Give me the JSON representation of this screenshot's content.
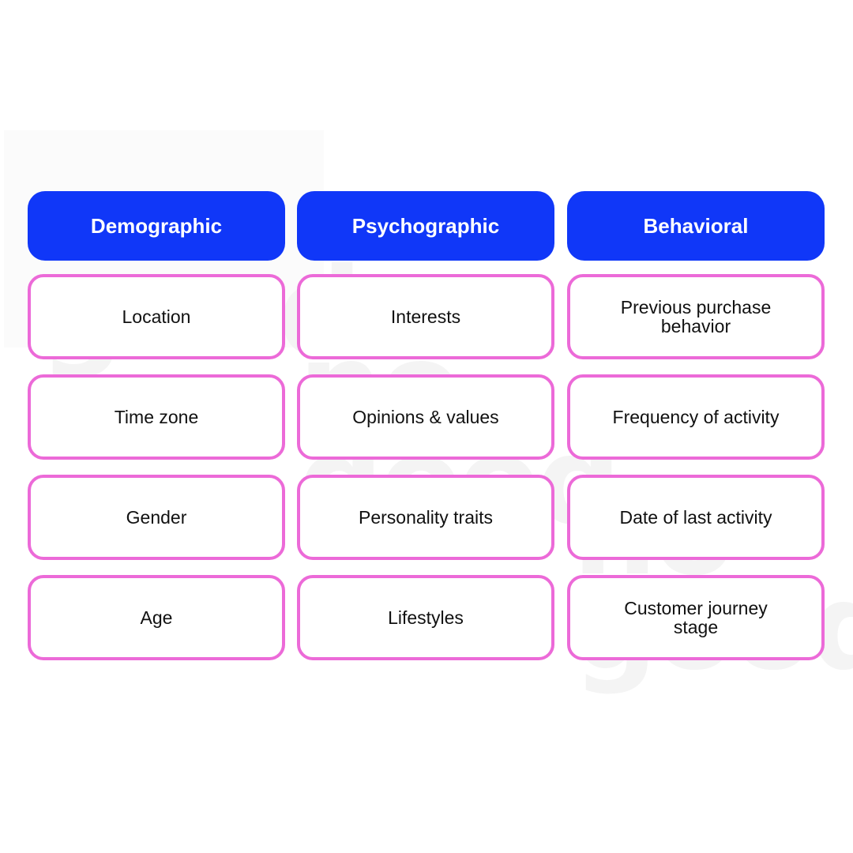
{
  "watermark": {
    "line1": "no",
    "line2": "good"
  },
  "colors": {
    "header_bg": "#1037f8",
    "cell_border": "#ec6ad8",
    "text": "#111111"
  },
  "columns": [
    {
      "header": "Demographic",
      "items": [
        "Location",
        "Time zone",
        "Gender",
        "Age"
      ]
    },
    {
      "header": "Psychographic",
      "items": [
        "Interests",
        "Opinions & values",
        "Personality traits",
        "Lifestyles"
      ]
    },
    {
      "header": "Behavioral",
      "items": [
        "Previous purchase behavior",
        "Frequency of activity",
        "Date of last activity",
        "Customer journey stage"
      ]
    }
  ]
}
